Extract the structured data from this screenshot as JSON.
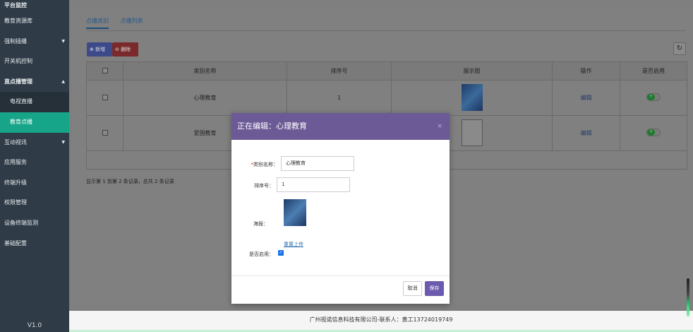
{
  "sidebar": {
    "items": [
      {
        "label": "平台监控"
      },
      {
        "label": "教育资源库"
      },
      {
        "label": "强制插播",
        "caret": "▼"
      },
      {
        "label": "开关机控制"
      },
      {
        "label": "直点播管理",
        "caret": "▲"
      },
      {
        "label": "电视直播"
      },
      {
        "label": "教育点播"
      },
      {
        "label": "互动视讯",
        "caret": "▼"
      },
      {
        "label": "应用服务"
      },
      {
        "label": "终端升级"
      },
      {
        "label": "权限管理"
      },
      {
        "label": "设备终端监测"
      },
      {
        "label": "基础配置"
      }
    ],
    "version": "V1.0"
  },
  "tabs": [
    {
      "label": "点播类别"
    },
    {
      "label": "点播列表"
    }
  ],
  "toolbar": {
    "add_label": "新增",
    "delete_label": "删除",
    "refresh_icon": "↻"
  },
  "table": {
    "headers": [
      "",
      "类别名称",
      "排序号",
      "展示图",
      "操作",
      "是否启用"
    ],
    "rows": [
      {
        "name": "心理教育",
        "order": "1",
        "action": "编辑",
        "enabled": "Y"
      },
      {
        "name": "爱国教育",
        "order": "",
        "action": "编辑",
        "enabled": "Y"
      }
    ]
  },
  "pager": {
    "summary": "显示第 1 到第 2 条记录，总共 2 条记录"
  },
  "modal": {
    "title": "正在编辑：心理教育",
    "close": "×",
    "fields": {
      "name_label": "类别名称：",
      "name_required": "*",
      "name_value": "心理教育",
      "order_label": "排序号：",
      "order_value": "1",
      "poster_label": "海报：",
      "reupload_label": "重置上传",
      "enabled_label": "是否启用：",
      "enabled_check": "✓"
    },
    "cancel_label": "取消",
    "save_label": "保存"
  },
  "footer": {
    "text": "广州视诺信息科技有限公司-联系人：黄工13724019749"
  },
  "colors": {
    "sidebar_bg": "#2f3b47",
    "active_item": "#17a589",
    "modal_header": "#6b5a96",
    "save_button": "#6b5aad"
  }
}
